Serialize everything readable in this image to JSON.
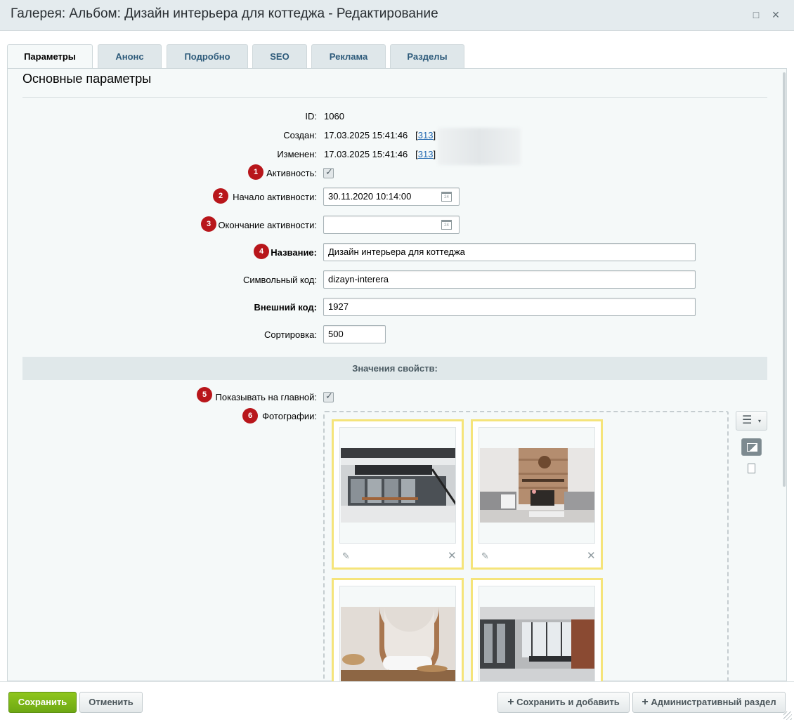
{
  "window": {
    "title": "Галерея: Альбом: Дизайн интерьера для коттеджа - Редактирование",
    "maximize_icon": "□",
    "close_icon": "×"
  },
  "tabs": [
    {
      "label": "Параметры",
      "active": true
    },
    {
      "label": "Анонс"
    },
    {
      "label": "Подробно"
    },
    {
      "label": "SEO"
    },
    {
      "label": "Реклама"
    },
    {
      "label": "Разделы"
    }
  ],
  "section": {
    "title": "Основные параметры"
  },
  "fields": {
    "id": {
      "label": "ID:",
      "value": "1060"
    },
    "created": {
      "label": "Создан:",
      "value": "17.03.2025 15:41:46",
      "user_prefix": "[",
      "user_link": "313",
      "user_suffix": "]"
    },
    "modified": {
      "label": "Изменен:",
      "value": "17.03.2025 15:41:46",
      "user_prefix": "[",
      "user_link": "313",
      "user_suffix": "]"
    },
    "active": {
      "badge": "1",
      "label": "Активность:",
      "checked": true
    },
    "active_from": {
      "badge": "2",
      "label": "Начало активности:",
      "value": "30.11.2020 10:14:00",
      "cal_icon": "24"
    },
    "active_to": {
      "badge": "3",
      "label": "Окончание активности:",
      "value": "",
      "cal_icon": "24"
    },
    "name": {
      "badge": "4",
      "label": "Название:",
      "value": "Дизайн интерьера для коттеджа"
    },
    "code": {
      "label": "Символьный код:",
      "value": "dizayn-interera"
    },
    "xml_id": {
      "label": "Внешний код:",
      "value": "1927"
    },
    "sort": {
      "label": "Сортировка:",
      "value": "500"
    }
  },
  "properties": {
    "header": "Значения свойств:",
    "show_on_main": {
      "badge": "5",
      "label": "Показывать на главной:",
      "checked": true
    },
    "photos": {
      "badge": "6",
      "label": "Фотографии:",
      "count": 4
    }
  },
  "photo_controls": {
    "menu_icon": "☰",
    "menu_arrow": "▾",
    "edit_icon": "✎",
    "remove_icon": "✕"
  },
  "footer": {
    "save": "Сохранить",
    "cancel": "Отменить",
    "save_and_add": "Сохранить и добавить",
    "admin_section": "Административный раздел",
    "plus_icon": "+"
  },
  "colors": {
    "accent_green": "#7ab317",
    "badge_red": "#b8161b",
    "photo_border": "#f5e47a",
    "link_blue": "#2067b0"
  }
}
